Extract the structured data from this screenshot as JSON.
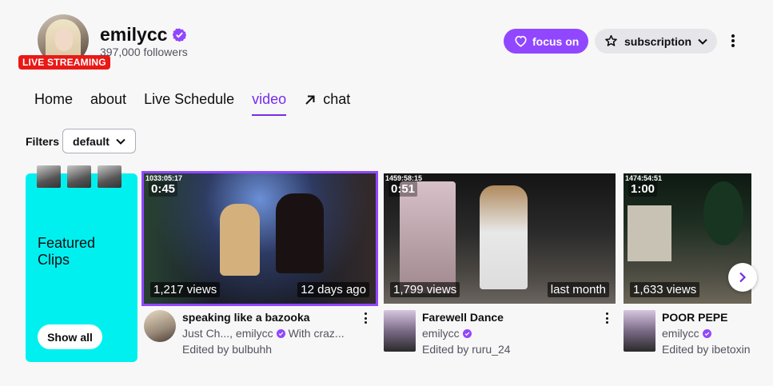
{
  "channel": {
    "name": "emilycc",
    "followers": "397,000 followers",
    "live_badge": "LIVE STREAMING"
  },
  "actions": {
    "focus_label": "focus on",
    "subscription_label": "subscription"
  },
  "tabs": [
    {
      "label": "Home"
    },
    {
      "label": "about"
    },
    {
      "label": "Live Schedule"
    },
    {
      "label": "video"
    },
    {
      "label": "chat"
    }
  ],
  "active_tab": "video",
  "filters": {
    "label": "Filters",
    "selected": "default"
  },
  "featured": {
    "title": "Featured Clips",
    "button_label": "Show all"
  },
  "videos": [
    {
      "timestamp": "1033:05:17",
      "duration": "0:45",
      "views": "1,217 views",
      "age": "12 days ago",
      "title": "speaking like a bazooka",
      "subtitle_prefix": "Just Ch..., emilycc",
      "subtitle_suffix": "With  craz...",
      "edited_by": "Edited by bulbuhh"
    },
    {
      "timestamp": "1459:58:15",
      "duration": "0:51",
      "views": "1,799 views",
      "age": "last month",
      "title": "Farewell Dance",
      "subtitle_prefix": "emilycc",
      "subtitle_suffix": "",
      "edited_by": "Edited by ruru_24"
    },
    {
      "timestamp": "1474:54:51",
      "duration": "1:00",
      "views": "1,633 views",
      "age": "",
      "title": "POOR PEPE",
      "subtitle_prefix": "emilycc",
      "subtitle_suffix": "",
      "edited_by": "Edited by ibetoxin"
    }
  ],
  "colors": {
    "accent": "#9147ff",
    "live": "#e91916",
    "featured_bg": "#00f0f0"
  }
}
